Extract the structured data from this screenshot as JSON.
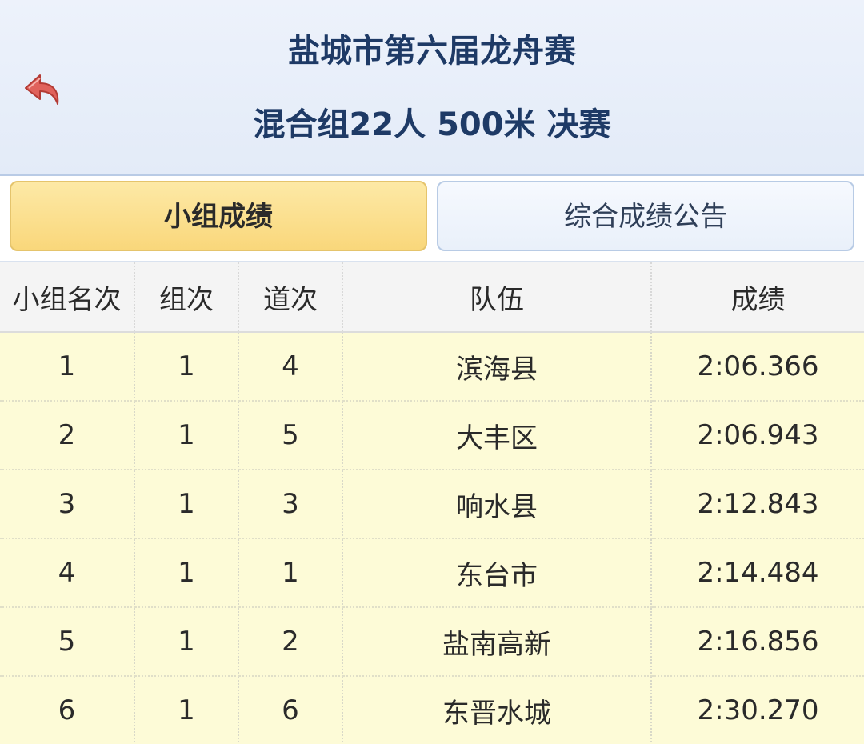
{
  "header": {
    "title": "盐城市第六届龙舟赛",
    "subtitle": "混合组22人 500米 决赛",
    "back_icon": "back-arrow-icon",
    "back_icon_color": "#d9534f"
  },
  "tabs": [
    {
      "label": "小组成绩",
      "active": true
    },
    {
      "label": "综合成绩公告",
      "active": false
    }
  ],
  "table": {
    "columns": [
      "小组名次",
      "组次",
      "道次",
      "队伍",
      "成绩"
    ],
    "rows": [
      {
        "rank": "1",
        "group": "1",
        "lane": "4",
        "team": "滨海县",
        "result": "2:06.366"
      },
      {
        "rank": "2",
        "group": "1",
        "lane": "5",
        "team": "大丰区",
        "result": "2:06.943"
      },
      {
        "rank": "3",
        "group": "1",
        "lane": "3",
        "team": "响水县",
        "result": "2:12.843"
      },
      {
        "rank": "4",
        "group": "1",
        "lane": "1",
        "team": "东台市",
        "result": "2:14.484"
      },
      {
        "rank": "5",
        "group": "1",
        "lane": "2",
        "team": "盐南高新",
        "result": "2:16.856"
      },
      {
        "rank": "6",
        "group": "1",
        "lane": "6",
        "team": "东晋水城",
        "result": "2:30.270"
      }
    ]
  },
  "colors": {
    "header_text": "#1e3a66",
    "active_tab": "#f9d77b",
    "row_background": "#fdfbd7"
  }
}
